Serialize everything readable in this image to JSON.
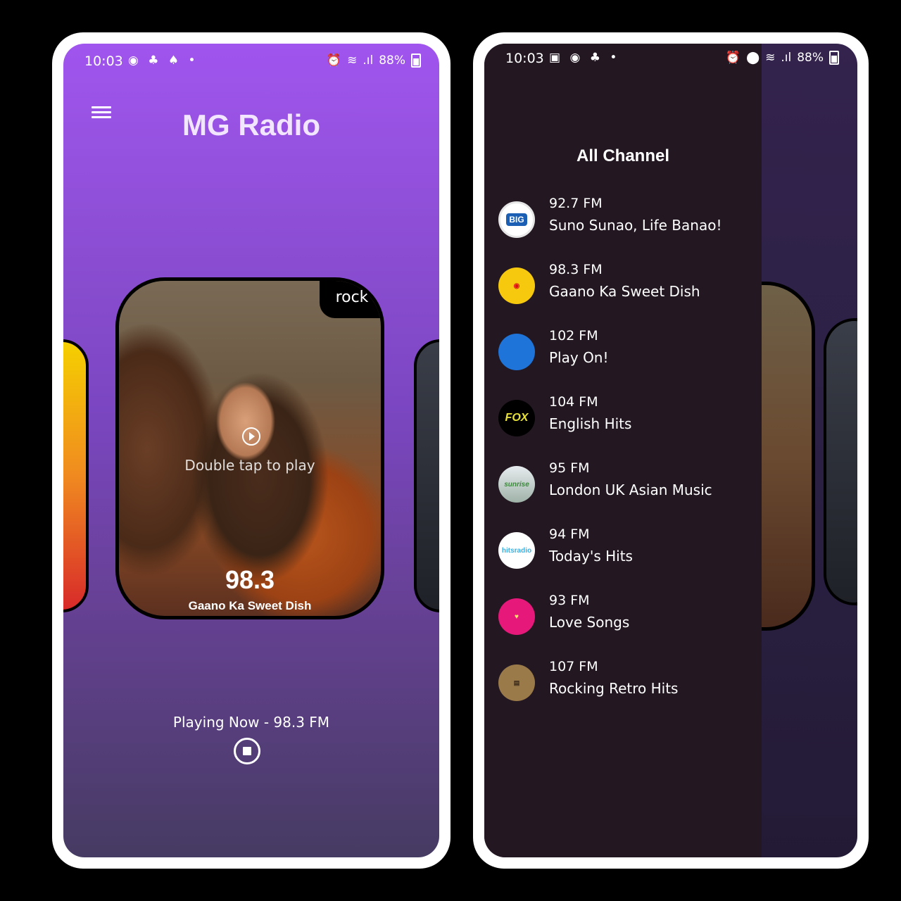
{
  "status_bar": {
    "time": "10:03",
    "left_icons": [
      "whatsapp-icon",
      "notification-icon",
      "snapchat-icon",
      "dot-icon"
    ],
    "battery": "88%",
    "network": "Vo) LTE1"
  },
  "left_screen": {
    "app_title": "MG Radio",
    "card": {
      "genre": "rock",
      "hint": "Double tap to play",
      "frequency": "98.3",
      "name": "Gaano Ka Sweet Dish"
    },
    "playing_now": "Playing Now - 98.3 FM"
  },
  "right_screen": {
    "background_genre": "rock",
    "drawer_title": "All Channel",
    "channels": [
      {
        "freq": "92.7 FM",
        "name": "Suno Sunao, Life Banao!",
        "logo": "BIG"
      },
      {
        "freq": "98.3 FM",
        "name": "Gaano Ka Sweet Dish",
        "logo": ""
      },
      {
        "freq": "102 FM",
        "name": "Play On!",
        "logo": ""
      },
      {
        "freq": "104 FM",
        "name": "English Hits",
        "logo": "FOX"
      },
      {
        "freq": "95 FM",
        "name": "London UK Asian Music",
        "logo": "sunrise"
      },
      {
        "freq": "94 FM",
        "name": "Today's Hits",
        "logo": "hitsradio"
      },
      {
        "freq": "93 FM",
        "name": "Love Songs",
        "logo": ""
      },
      {
        "freq": "107 FM",
        "name": "Rocking Retro Hits",
        "logo": ""
      }
    ]
  },
  "colors": {
    "accent_purple": "#9b50e6",
    "drawer_bg": "#231822",
    "frame": "#ffffff"
  }
}
